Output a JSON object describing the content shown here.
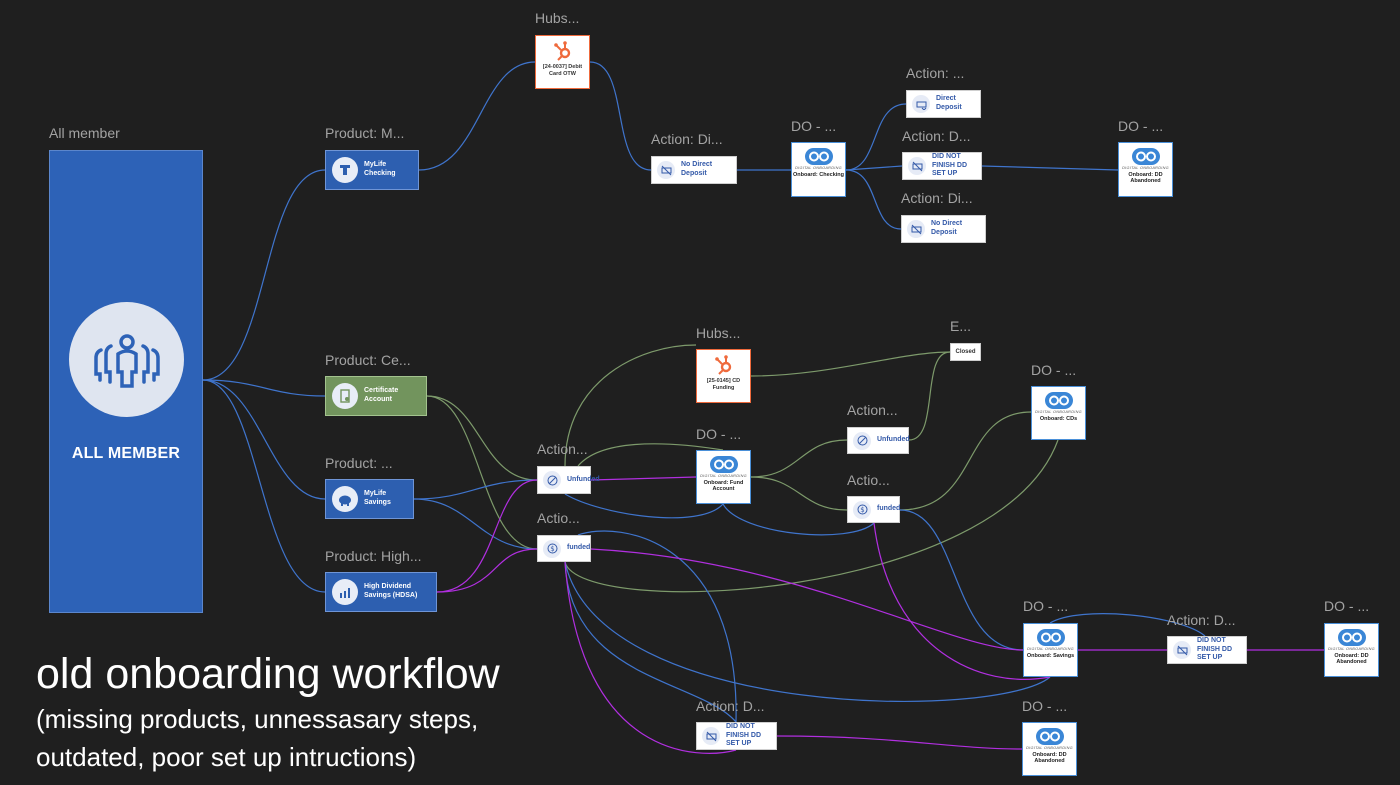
{
  "title": "old onboarding workflow",
  "subtitle_line1": "(missing products, unnessasary steps,",
  "subtitle_line2": "outdated, poor set up intructions)",
  "root": {
    "label": "All member",
    "text": "ALL MEMBER"
  },
  "labels": {
    "hubs1": "Hubs...",
    "prod_checking": "Product: M...",
    "action_di1": "Action: Di...",
    "do_1": "DO - ...",
    "action_top": "Action: ...",
    "action_d1": "Action: D...",
    "action_di2": "Action: Di...",
    "do_2": "DO - ...",
    "prod_cert": "Product: Ce...",
    "hubs2": "Hubs...",
    "e": "E...",
    "do_cds": "DO - ...",
    "action_unf2": "Action...",
    "action_unf1": "Action...",
    "do_fund": "DO - ...",
    "action_fund2": "Actio...",
    "prod_savings": "Product: ...",
    "action_fund1": "Actio...",
    "prod_high": "Product: High...",
    "do_sav": "DO - ...",
    "action_d2": "Action: D...",
    "do_abd2": "DO - ...",
    "action_d3": "Action: D...",
    "do_abd3": "DO - ..."
  },
  "nodes": {
    "checking": "MyLife Checking",
    "certificate": "Certificate Account",
    "savings": "MyLife Savings",
    "hdsa": "High Dividend Savings (HDSA)",
    "hub1": "[24-0037] Debit Card OTW",
    "hub2": "[25-0145] CD Funding",
    "no_dd_1": "No Direct Deposit",
    "direct_deposit": "Direct Deposit",
    "dnf_1": "DID NOT FINISH DD SET UP",
    "no_dd_2": "No Direct Deposit",
    "closed": "Closed",
    "unfunded_1": "Unfunded",
    "unfunded_2": "Unfunded",
    "funded_1": "funded",
    "funded_2": "funded",
    "dnf_2": "DID NOT FINISH DD SET UP",
    "dnf_3": "DID NOT FINISH DD SET UP"
  },
  "do_nodes": {
    "tagline": "DIGITAL ONBOARDING",
    "checking": "Onboard: Checking",
    "abandoned_1": "Onboard: DD Abandoned",
    "cds": "Onboard: CDs",
    "fund": "Onboard: Fund Account",
    "savings": "Onboard: Savings",
    "abandoned_2": "Onboard: DD Abandoned",
    "abandoned_3": "Onboard: DD Abandoned"
  },
  "colors": {
    "blue_edge": "#3f74cc",
    "green_edge": "#7d9a6b",
    "purple_edge": "#b12fe0",
    "hub_orange": "#ef6a3c",
    "do_blue": "#3a86d6"
  },
  "icons": [
    "people-group-icon",
    "checking-icon",
    "certificate-icon",
    "piggy-bank-icon",
    "chart-growth-icon",
    "hubspot-icon",
    "no-deposit-icon",
    "direct-deposit-icon",
    "dollar-icon",
    "no-dollar-icon",
    "digital-onboarding-logo"
  ]
}
